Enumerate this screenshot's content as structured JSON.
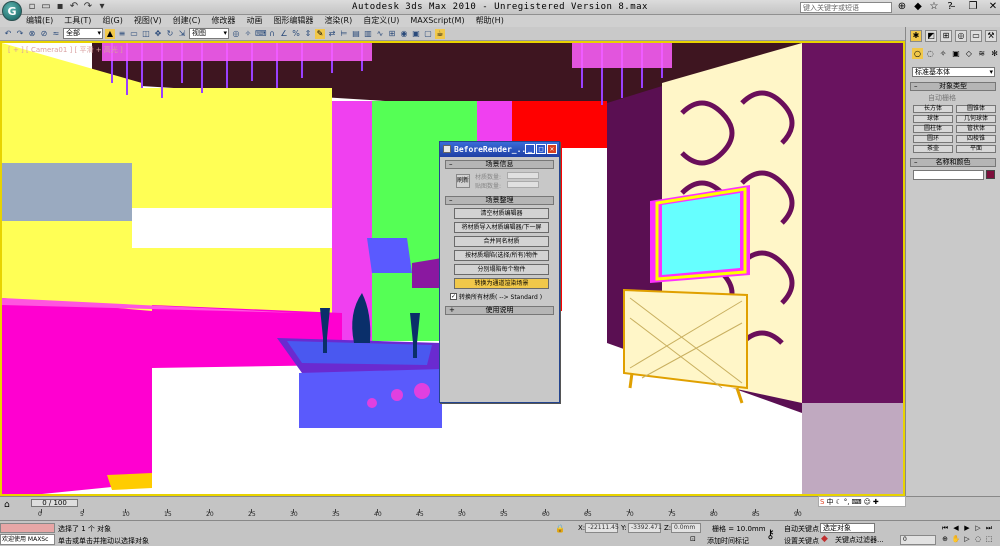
{
  "window": {
    "title": "Autodesk 3ds Max  2010   - Unregistered Version  8.max",
    "logo": "G",
    "help_search_placeholder": "键入关键字或短语"
  },
  "menubar": [
    "编辑(E)",
    "工具(T)",
    "组(G)",
    "视图(V)",
    "创建(C)",
    "修改器",
    "动画",
    "图形编辑器",
    "渲染(R)",
    "自定义(U)",
    "MAXScript(M)",
    "帮助(H)"
  ],
  "toolbar": {
    "selection_filter": "全部",
    "ref_coord": "视图"
  },
  "viewport": {
    "label": "[ + ] [ Camera01 ] [ 平滑 + 高光 ]"
  },
  "dialog": {
    "title": "BeforeRender_...",
    "section_scene_info": "场景信息",
    "refresh_label": "刷新",
    "material_count_label": "材质数量:",
    "map_count_label": "贴图数量:",
    "section_scene_ops": "场景整理",
    "buttons": [
      "清空材质编辑器",
      "将材质导入材质编辑器/下一屏",
      "合并同名材质",
      "按材质塌陷(选择/所有)物件",
      "分别塌陷每个物件",
      "转换为通道渲染场景"
    ],
    "checkbox_label": "转换所有材质( --> Standard )",
    "checkbox_checked": true,
    "section_help": "使用说明"
  },
  "command_panel": {
    "dropdown": "标准基本体",
    "object_type_rollout": "对象类型",
    "autogrid": "自动栅格",
    "objects": [
      "长方体",
      "圆锥体",
      "球体",
      "几何球体",
      "圆柱体",
      "管状体",
      "圆环",
      "四棱锥",
      "茶壶",
      "平面"
    ],
    "name_color_rollout": "名称和颜色",
    "object_color": "#7d0f3c"
  },
  "timeline": {
    "slider": "0 / 100",
    "ticks": [
      0,
      5,
      10,
      15,
      20,
      25,
      30,
      35,
      40,
      45,
      50,
      55,
      60,
      65,
      70,
      75,
      80,
      85,
      90
    ]
  },
  "status": {
    "listener_text": "欢迎使用 MAXSc",
    "selection": "选择了 1 个 对象",
    "prompt": "单击或单击并拖动以选择对象",
    "x_label": "X:",
    "x_value": "-22111.45",
    "y_label": "Y:",
    "y_value": "-3392.471",
    "z_label": "Z:",
    "z_value": "0.0mm",
    "grid": "栅格 = 10.0mm",
    "add_time_tag": "添加时间标记",
    "auto_key": "自动关键点",
    "set_key": "设置关键点",
    "selected_object": "选定对象",
    "key_filters": "关键点过滤器...",
    "frame_field": "0"
  }
}
